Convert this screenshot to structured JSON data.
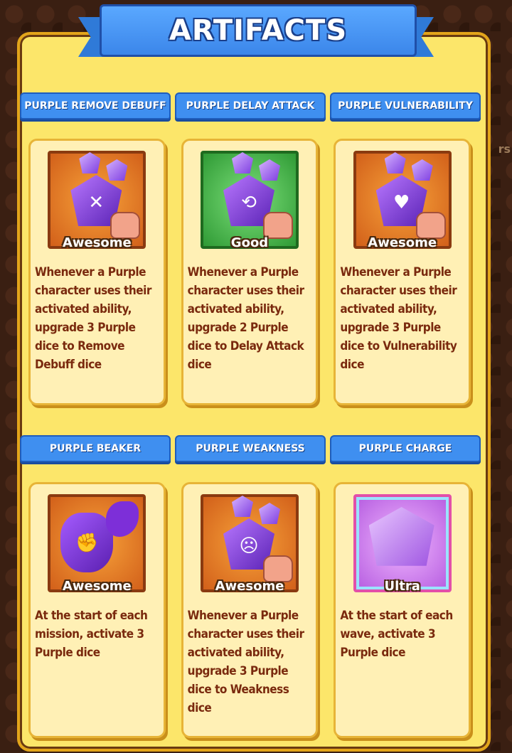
{
  "header": {
    "title": "ARTIFACTS"
  },
  "rows": [
    {
      "artifacts": [
        {
          "name": "PURPLE REMOVE DEBUFF",
          "rarity": "Awesome",
          "icon": "dice-remove-debuff-icon",
          "symbol": "✕",
          "bg": "orange",
          "description": "Whenever a Purple character uses their activated ability, upgrade 3 Purple dice to Remove Debuff dice"
        },
        {
          "name": "PURPLE DELAY ATTACK",
          "rarity": "Good",
          "icon": "dice-delay-attack-icon",
          "symbol": "⟲",
          "bg": "green",
          "description": "Whenever a Purple character uses their activated ability, upgrade 2 Purple dice to Delay Attack dice"
        },
        {
          "name": "PURPLE VULNERABILITY",
          "rarity": "Awesome",
          "icon": "dice-vulnerability-icon",
          "symbol": "♥",
          "bg": "orange",
          "description": "Whenever a Purple character uses their activated ability, upgrade 3 Purple dice to Vulnerability dice"
        }
      ]
    },
    {
      "artifacts": [
        {
          "name": "PURPLE BEAKER",
          "rarity": "Awesome",
          "icon": "purple-beaker-icon",
          "symbol": "✊",
          "bg": "orange",
          "description": "At the start of each mission, activate 3 Purple dice"
        },
        {
          "name": "PURPLE WEAKNESS",
          "rarity": "Awesome",
          "icon": "dice-weakness-icon",
          "symbol": "☹",
          "bg": "orange",
          "description": "Whenever a Purple character uses their activated ability, upgrade 3 Purple dice to Weakness dice"
        },
        {
          "name": "PURPLE CHARGE",
          "rarity": "Ultra",
          "icon": "ultra-purple-die-icon",
          "symbol": "",
          "bg": "ultra",
          "description": "At the start of each wave, activate 3 Purple dice"
        }
      ]
    }
  ],
  "background_hint": "rs",
  "colors": {
    "panel": "#fce66a",
    "tab": "#3f8ff0",
    "card": "#fff0b5",
    "text": "#7a2a0e"
  }
}
